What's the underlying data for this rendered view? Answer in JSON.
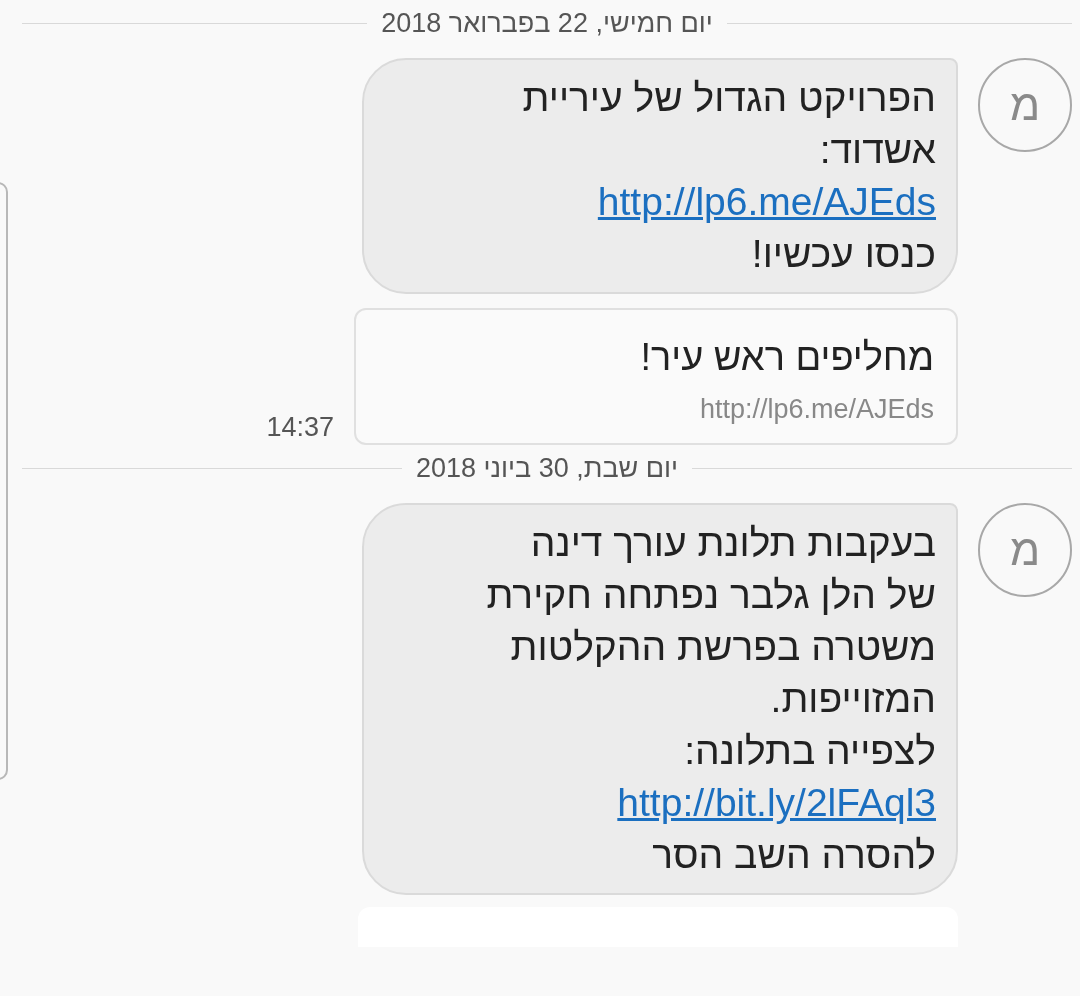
{
  "items": [
    {
      "kind": "date",
      "text": "יום חמישי, 22 בפברואר 2018"
    },
    {
      "kind": "message",
      "avatar": "מ",
      "lines": [
        {
          "kind": "text",
          "text": "הפרויקט הגדול של עיריית"
        },
        {
          "kind": "text",
          "text": "אשדוד:"
        },
        {
          "kind": "link",
          "text": "http://lp6.me/AJEds"
        },
        {
          "kind": "text",
          "text": "כנסו עכשיו!"
        }
      ]
    },
    {
      "kind": "preview",
      "title": "מחליפים ראש עיר!",
      "url": "http://lp6.me/AJEds",
      "time": "14:37"
    },
    {
      "kind": "date",
      "text": "יום שבת, 30 ביוני 2018"
    },
    {
      "kind": "message",
      "avatar": "מ",
      "lines": [
        {
          "kind": "text",
          "text": "בעקבות תלונת עורך דינה"
        },
        {
          "kind": "text",
          "text": "של הלן גלבר נפתחה חקירת"
        },
        {
          "kind": "text",
          "text": "משטרה בפרשת ההקלטות"
        },
        {
          "kind": "text",
          "text": "המזוייפות."
        },
        {
          "kind": "text",
          "text": "לצפייה בתלונה:"
        },
        {
          "kind": "link",
          "text": "http://bit.ly/2lFAql3"
        },
        {
          "kind": "text",
          "text": "להסרה השב הסר"
        }
      ]
    },
    {
      "kind": "card"
    }
  ]
}
